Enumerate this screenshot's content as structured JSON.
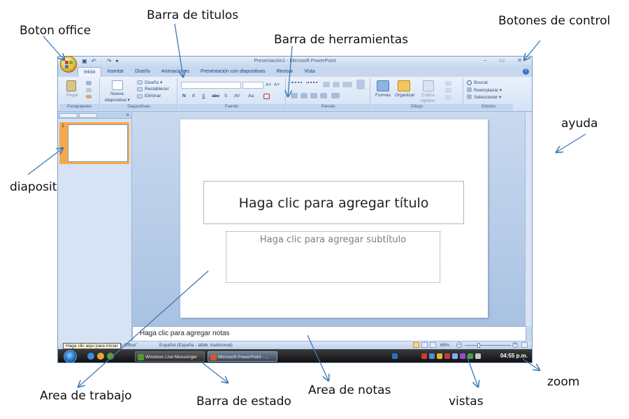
{
  "annotations": {
    "office_button": "Boton office",
    "title_bar": "Barra  de titulos",
    "toolbar": "Barra de herramientas",
    "control_buttons": "Botones de control",
    "help": "ayuda",
    "slide": "diapositiva",
    "work_area": "Area de trabajo",
    "status_bar": "Barra de estado",
    "notes_area": "Area de notas",
    "views": "vistas",
    "zoom": "zoom"
  },
  "window": {
    "title": "Presentación1 - Microsoft PowerPoint",
    "quick_access": "▣ ↶ · ↷ ▾",
    "controls": "– ▭ ✕",
    "help_symbol": "?"
  },
  "tabs": [
    "Inicio",
    "Insertar",
    "Diseño",
    "Animaciones",
    "Presentación con diapositivas",
    "Revisar",
    "Vista"
  ],
  "ribbon": {
    "clipboard": {
      "name": "Portapapeles",
      "paste": "Pegar"
    },
    "slides": {
      "name": "Diapositivas",
      "new_slide_1": "Nueva",
      "new_slide_2": "diapositiva ▾",
      "layout": "Diseño ▾",
      "reset": "Restablecer",
      "delete": "Eliminar"
    },
    "font": {
      "name": "Fuente",
      "bold": "N",
      "italic": "K",
      "underline": "S",
      "strike": "abe",
      "shadow": "S",
      "spacing": "AV",
      "case": "Aa",
      "grow": "A˄",
      "shrink": "A˅"
    },
    "paragraph": {
      "name": "Párrafo"
    },
    "drawing": {
      "name": "Dibujo",
      "shapes": "Formas",
      "arrange": "Organizar",
      "styles_1": "Estilos",
      "styles_2": "rápidos"
    },
    "editing": {
      "name": "Edición",
      "find": "Buscar",
      "replace": "Reemplazar ▾",
      "select": "Seleccionar ▾"
    }
  },
  "slide_pane": {
    "number": "1"
  },
  "slide": {
    "title_placeholder": "Haga clic para agregar título",
    "subtitle_placeholder": "Haga clic para agregar subtítulo"
  },
  "notes": {
    "placeholder": "Haga clic para agregar notas"
  },
  "status": {
    "tooltip": "Haga clic aquí para iniciar",
    "theme": "a de Office\"",
    "language": "Español (España - alfab. tradicional)",
    "zoom_level": "69%",
    "zoom_out": "–",
    "zoom_in": "+",
    "zoom_fraction": 0.31
  },
  "taskbar": {
    "messenger": "Windows Live Messenger",
    "powerpoint": "Microsoft PowerPoint - ...",
    "clock": "04:55 p.m."
  },
  "colors": {
    "ribbon_text": "#15428b",
    "slide_thumb_highlight": "#f6a94c",
    "taskbar": "#1a1a1a",
    "arrow": "#3f78b5"
  }
}
